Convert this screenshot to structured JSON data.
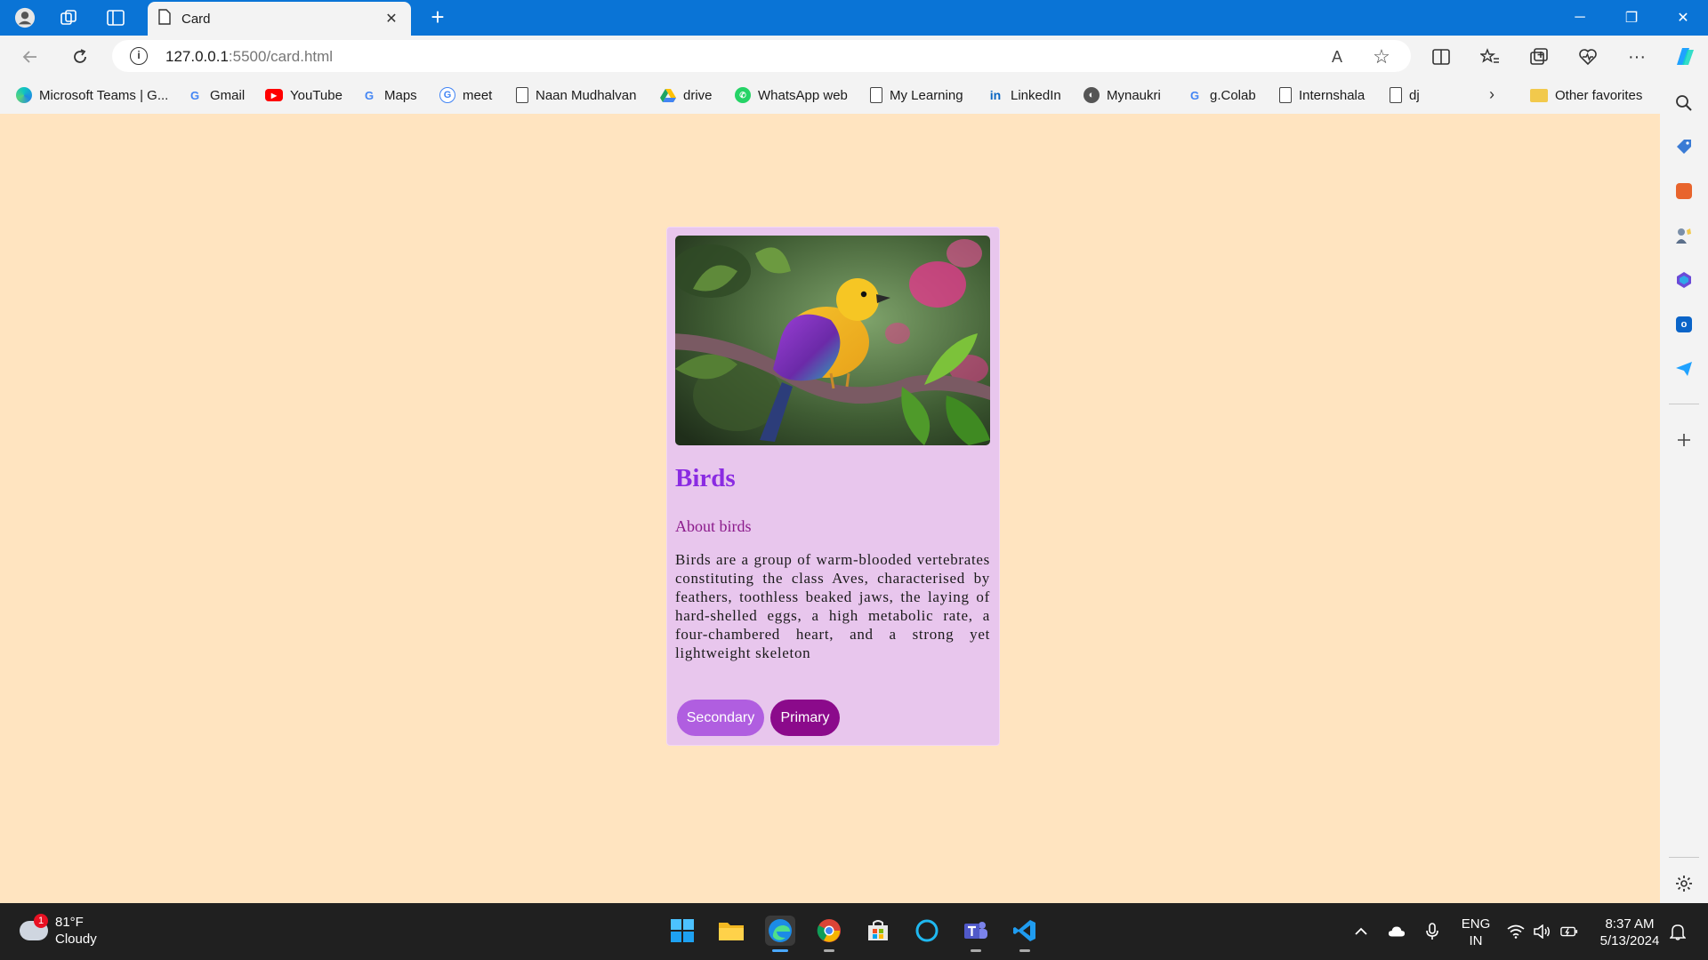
{
  "browser": {
    "tab_title": "Card",
    "tab_close": "✕",
    "new_tab": "+",
    "window_controls": {
      "minimize": "─",
      "restore": "❐",
      "close": "✕"
    },
    "address": {
      "host": "127.0.0.1",
      "path": ":5500/card.html",
      "info_icon": "i"
    },
    "toolbar_glyphs": {
      "read_aloud": "A",
      "favorite": "☆",
      "more": "···"
    }
  },
  "favorites": [
    {
      "label": "Microsoft Teams | G...",
      "icon": "edge-icon",
      "color": "#1e88e5"
    },
    {
      "label": "Gmail",
      "icon": "google-icon",
      "color": "#4285f4"
    },
    {
      "label": "YouTube",
      "icon": "youtube-icon",
      "color": "#ff0000"
    },
    {
      "label": "Maps",
      "icon": "google-icon",
      "color": "#4285f4"
    },
    {
      "label": "meet",
      "icon": "google-icon",
      "color": "#4285f4"
    },
    {
      "label": "Naan Mudhalvan",
      "icon": "page-icon",
      "color": "#444444"
    },
    {
      "label": "drive",
      "icon": "drive-icon",
      "color": "#1fa463"
    },
    {
      "label": "WhatsApp web",
      "icon": "whatsapp-icon",
      "color": "#25d366"
    },
    {
      "label": "My Learning",
      "icon": "page-icon",
      "color": "#444444"
    },
    {
      "label": "LinkedIn",
      "icon": "linkedin-icon",
      "color": "#0a66c2"
    },
    {
      "label": "Mynaukri",
      "icon": "naukri-icon",
      "color": "#444444"
    },
    {
      "label": "g.Colab",
      "icon": "google-icon",
      "color": "#4285f4"
    },
    {
      "label": "Internshala",
      "icon": "page-icon",
      "color": "#444444"
    },
    {
      "label": "dj",
      "icon": "page-icon",
      "color": "#444444"
    }
  ],
  "favorites_more": "›",
  "other_favorites": "Other favorites",
  "card": {
    "title": "Birds",
    "subtitle": "About birds",
    "body": "Birds are a group of warm-blooded vertebrates constituting the class Aves, characterised by feathers, toothless beaked jaws, the laying of hard-shelled eggs, a high metabolic rate, a four-chambered heart, and a strong yet lightweight skeleton",
    "secondary_button": "Secondary",
    "primary_button": "Primary",
    "colors": {
      "background": "#e8c6ed",
      "title": "#8a2be2",
      "subtitle": "#8b1a8b",
      "secondary": "#b05ee0",
      "primary": "#8b0a8b"
    }
  },
  "page_background": "#ffe4c0",
  "taskbar": {
    "weather": {
      "temp": "81°F",
      "condition": "Cloudy",
      "badge": "1"
    },
    "language": {
      "line1": "ENG",
      "line2": "IN"
    },
    "clock": {
      "time": "8:37 AM",
      "date": "5/13/2024"
    }
  }
}
